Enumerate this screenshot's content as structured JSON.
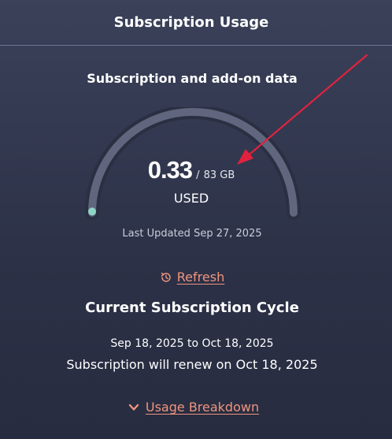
{
  "header": {
    "title": "Subscription Usage"
  },
  "usage": {
    "section_title": "Subscription and add-on data",
    "used_value": "0.33",
    "separator": "/",
    "total": "83 GB",
    "used_label": "USED",
    "fraction_used": 0.004,
    "last_updated": "Last Updated Sep 27, 2025",
    "refresh_label": "Refresh"
  },
  "cycle": {
    "title": "Current Subscription Cycle",
    "dates": "Sep 18, 2025 to Oct 18, 2025",
    "renew": "Subscription will renew on Oct 18, 2025"
  },
  "breakdown": {
    "label": "Usage Breakdown"
  },
  "colors": {
    "accent_link": "#f0957e",
    "gauge_fill": "#8fd3c4",
    "gauge_track": "#5f667d",
    "annotation_arrow": "#e0223f"
  }
}
